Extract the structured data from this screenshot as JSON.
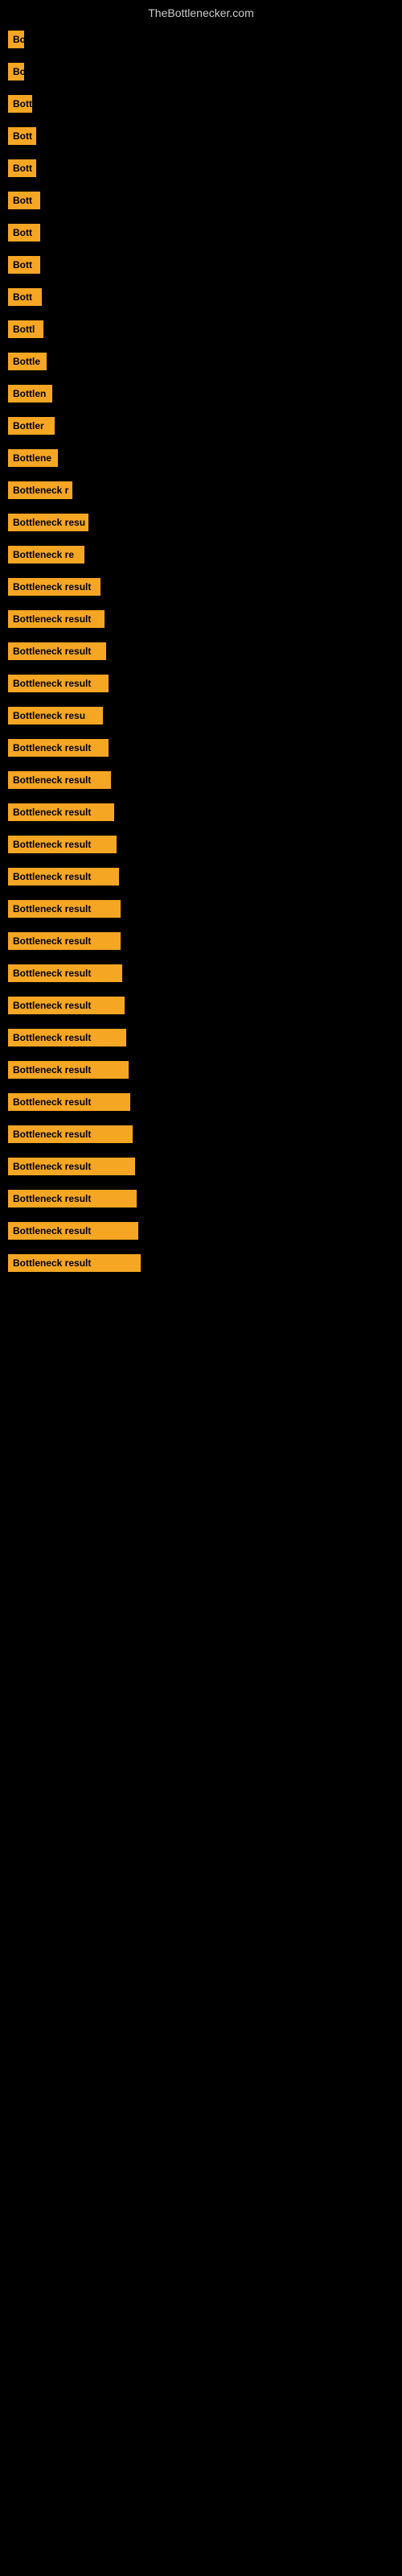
{
  "site": {
    "title": "TheBottlenecker.com"
  },
  "items": [
    {
      "label": "Bo",
      "width": 20
    },
    {
      "label": "Bo",
      "width": 20
    },
    {
      "label": "Bott",
      "width": 30
    },
    {
      "label": "Bott",
      "width": 35
    },
    {
      "label": "Bott",
      "width": 35
    },
    {
      "label": "Bott",
      "width": 40
    },
    {
      "label": "Bott",
      "width": 40
    },
    {
      "label": "Bott",
      "width": 40
    },
    {
      "label": "Bott",
      "width": 42
    },
    {
      "label": "Bottl",
      "width": 44
    },
    {
      "label": "Bottle",
      "width": 48
    },
    {
      "label": "Bottlen",
      "width": 55
    },
    {
      "label": "Bottler",
      "width": 58
    },
    {
      "label": "Bottlene",
      "width": 62
    },
    {
      "label": "Bottleneck r",
      "width": 80
    },
    {
      "label": "Bottleneck resu",
      "width": 100
    },
    {
      "label": "Bottleneck re",
      "width": 95
    },
    {
      "label": "Bottleneck result",
      "width": 115
    },
    {
      "label": "Bottleneck result",
      "width": 120
    },
    {
      "label": "Bottleneck result",
      "width": 122
    },
    {
      "label": "Bottleneck result",
      "width": 125
    },
    {
      "label": "Bottleneck resu",
      "width": 118
    },
    {
      "label": "Bottleneck result",
      "width": 125
    },
    {
      "label": "Bottleneck result",
      "width": 128
    },
    {
      "label": "Bottleneck result",
      "width": 132
    },
    {
      "label": "Bottleneck result",
      "width": 135
    },
    {
      "label": "Bottleneck result",
      "width": 138
    },
    {
      "label": "Bottleneck result",
      "width": 140
    },
    {
      "label": "Bottleneck result",
      "width": 140
    },
    {
      "label": "Bottleneck result",
      "width": 142
    },
    {
      "label": "Bottleneck result",
      "width": 145
    },
    {
      "label": "Bottleneck result",
      "width": 147
    },
    {
      "label": "Bottleneck result",
      "width": 150
    },
    {
      "label": "Bottleneck result",
      "width": 152
    },
    {
      "label": "Bottleneck result",
      "width": 155
    },
    {
      "label": "Bottleneck result",
      "width": 158
    },
    {
      "label": "Bottleneck result",
      "width": 160
    },
    {
      "label": "Bottleneck result",
      "width": 162
    },
    {
      "label": "Bottleneck result",
      "width": 165
    }
  ]
}
